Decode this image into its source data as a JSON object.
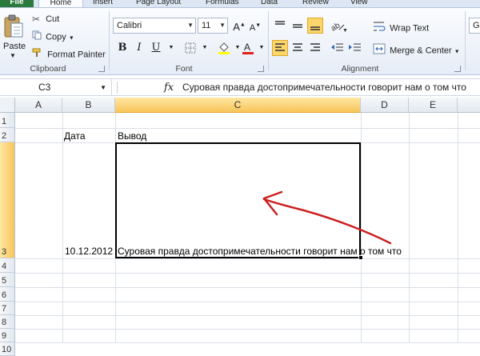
{
  "tabs": [
    "File",
    "Home",
    "Insert",
    "Page Layout",
    "Formulas",
    "Data",
    "Review",
    "View"
  ],
  "clipboard": {
    "paste": "Paste",
    "cut": "Cut",
    "copy": "Copy",
    "format_painter": "Format Painter",
    "group_label": "Clipboard"
  },
  "font": {
    "name": "Calibri",
    "size": "11",
    "bold": "B",
    "italic": "I",
    "underline": "U",
    "group_label": "Font"
  },
  "alignment": {
    "wrap_text": "Wrap Text",
    "merge_center": "Merge & Center",
    "group_label": "Alignment"
  },
  "number": {
    "format_partial": "Ge"
  },
  "formula_bar": {
    "name_box": "C3",
    "fx": "fx",
    "content": "Суровая правда достопримечательности говорит нам о том что"
  },
  "columns": [
    "A",
    "B",
    "C",
    "D",
    "E"
  ],
  "rows": [
    "1",
    "2",
    "3",
    "4",
    "5",
    "6",
    "7",
    "8",
    "9",
    "10"
  ],
  "cells": {
    "B2": "Дата",
    "C2": "Вывод",
    "B3": "10.12.2012",
    "C3": "Суровая правда достопримечательности говорит нам о том что"
  },
  "colors": {
    "file_tab": "#2b7a3d",
    "selected_header": "#f8c55b",
    "annotation_arrow": "#cc1f1f",
    "font_color_bar": "#e02020",
    "highlight_bar": "#ffff00"
  }
}
